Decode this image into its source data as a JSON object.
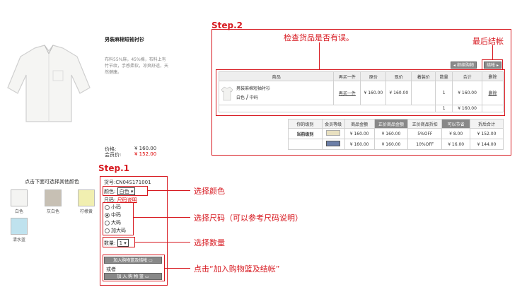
{
  "product": {
    "name": "男装麻棉短袖衬衫",
    "description": "布料55%麻，45%棉，布料上有竹节纹，手感柔软，凉爽舒适，天然健康。",
    "price_label": "价格:",
    "price": "¥ 160.00",
    "member_price_label": "会员价:",
    "member_price": "¥ 152.00"
  },
  "colors": {
    "header": "点击下面可选择其他颜色",
    "items": [
      "白色",
      "灰白色",
      "柠檬黄",
      "清水蓝"
    ],
    "swatch_colors": [
      "#f4f4f2",
      "#c7c0b4",
      "#f1efb0",
      "#bfe2ee"
    ]
  },
  "step1": {
    "title": "Step.1",
    "sku": "货号:CN04S171001",
    "color_label": "颜色:",
    "color_value": "白色",
    "size_label": "尺码:",
    "size_link": "尺码说明",
    "sizes": [
      "小码",
      "中码",
      "大码",
      "加大码"
    ],
    "selected_size": "中码",
    "qty_label": "数量:",
    "qty_value": "1",
    "btn_add_checkout": "加入购物篮及结帐",
    "or_text": "或者",
    "btn_add": "加 入 购 物 篮"
  },
  "annotations": {
    "choose_color": "选择颜色",
    "choose_size": "选择尺码（可以参考尺码说明）",
    "choose_qty": "选择数量",
    "click_add": "点击“加入购物篮及结帐”",
    "check_goods": "检查货品是否有误。",
    "final_checkout": "最后结帐"
  },
  "step2": {
    "title": "Step.2",
    "btn_continue": "继续购物",
    "btn_checkout": "结帐",
    "headers": [
      "商品",
      "再买一件",
      "原价",
      "现价",
      "着装价",
      "数量",
      "合计",
      "删除"
    ],
    "item": {
      "name": "男装麻棉短袖衬衫",
      "color": "白色",
      "slash": "/",
      "size": "中码",
      "buy_again": "再买一件",
      "orig": "¥ 160.00",
      "now": "¥ 160.00",
      "qty": "1",
      "total": "¥ 160.00",
      "delete": "删除"
    },
    "summary_qty": "1",
    "summary_total": "¥ 160.00",
    "level_headers": [
      "你的级别",
      "会员等级",
      "商品金额",
      "正价商品金额",
      "正价商品折扣",
      "可以节省",
      "折后合计"
    ],
    "level_rows": [
      {
        "level": "当前级别",
        "amount": "¥ 160.00",
        "full_amount": "¥ 160.00",
        "discount": "5%OFF",
        "save": "¥ 8.00",
        "final": "¥ 152.00"
      },
      {
        "level": "",
        "amount": "¥ 160.00",
        "full_amount": "¥ 160.00",
        "discount": "10%OFF",
        "save": "¥ 16.00",
        "final": "¥ 144.00"
      }
    ]
  }
}
